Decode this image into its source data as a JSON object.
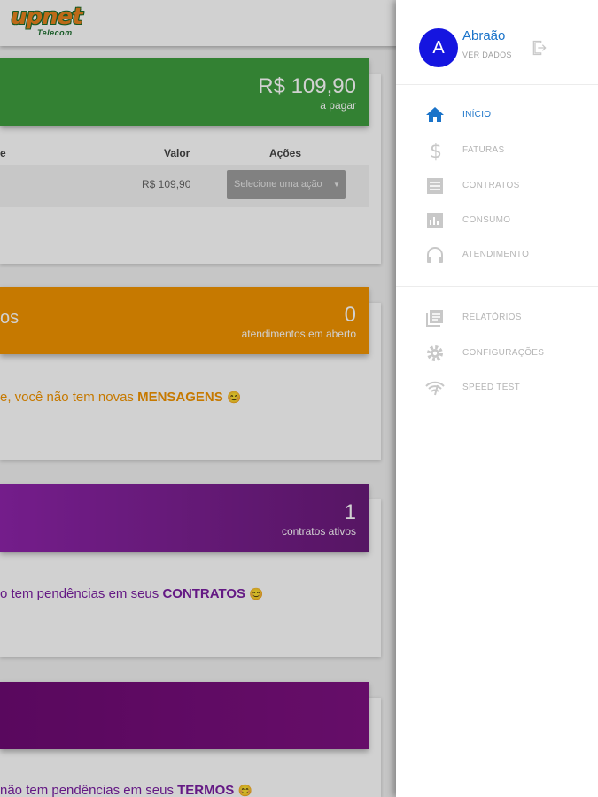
{
  "logo": {
    "word": "upnet",
    "sub": "Telecom"
  },
  "cards": {
    "invoice": {
      "amount": "R$ 109,90",
      "amount_sub": "a pagar",
      "col_valor": "Valor",
      "col_acoes": "Ações",
      "row_value": "R$ 109,90",
      "select_placeholder": "Selecione uma ação"
    },
    "tickets": {
      "title_fragment": "os",
      "count": "0",
      "count_sub": "atendimentos em aberto",
      "message_prefix": "e, você não tem novas ",
      "message_bold": "MENSAGENS",
      "emoji": "😊"
    },
    "contracts": {
      "count": "1",
      "count_sub": "contratos ativos",
      "message_prefix": "o tem pendências em seus ",
      "message_bold": "CONTRATOS",
      "emoji": "😊"
    },
    "terms": {
      "message_prefix": "não tem pendências em seus ",
      "message_bold": "TERMOS",
      "emoji": "😊"
    }
  },
  "drawer": {
    "avatar_letter": "A",
    "user_name": "Abraão",
    "user_link": "VER DADOS",
    "menu_primary": [
      {
        "label": "INÍCIO",
        "icon": "home-icon"
      },
      {
        "label": "FATURAS",
        "icon": "dollar-icon"
      },
      {
        "label": "CONTRATOS",
        "icon": "document-icon"
      },
      {
        "label": "CONSUMO",
        "icon": "chart-icon"
      },
      {
        "label": "ATENDIMENTO",
        "icon": "headset-icon"
      }
    ],
    "menu_secondary": [
      {
        "label": "RELATÓRIOS",
        "icon": "report-icon"
      },
      {
        "label": "CONFIGURAÇÕES",
        "icon": "gear-icon"
      },
      {
        "label": "SPEED TEST",
        "icon": "wifi-icon"
      }
    ]
  },
  "colors": {
    "green": "#3f9e3f",
    "orange": "#f29400",
    "purple": "#8e24aa",
    "primary_blue": "#1a73c9",
    "avatar_blue": "#1515e0"
  }
}
